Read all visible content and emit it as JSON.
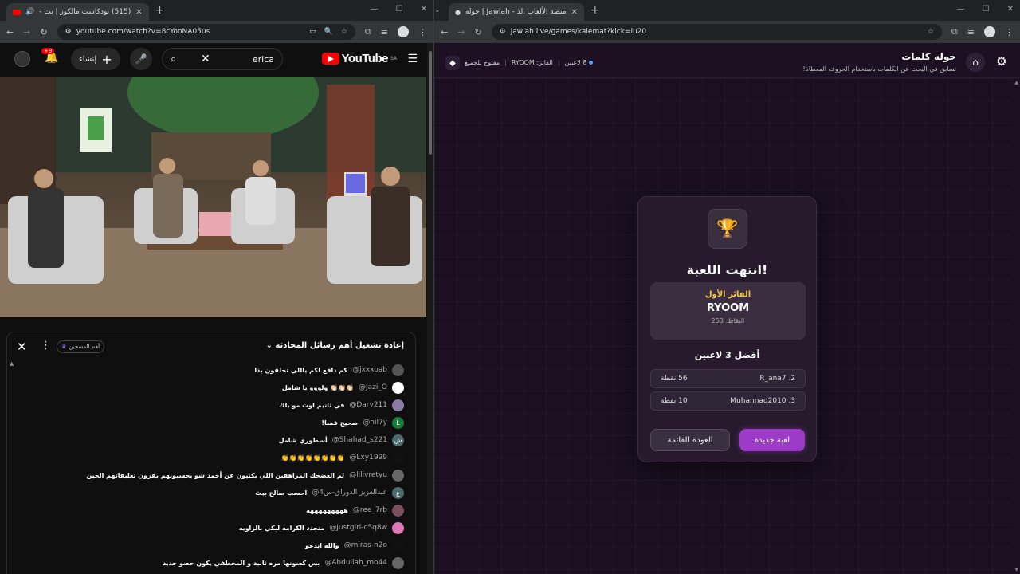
{
  "left": {
    "tab_title": "(515) بودكاست مالكوز | بت -",
    "url": "youtube.com/watch?v=8cYooNA05us",
    "yt": {
      "search_query": "erica",
      "region": "SA",
      "create_label": "إنشاء",
      "notif_count": "+9",
      "logo_text": "YouTube"
    },
    "chat": {
      "title": "إعادة تشغيل أهم رسائل المحادثة",
      "members_pill": "أهم المسجين",
      "messages": [
        {
          "author": "@jxxxoab",
          "text": "كم دافع لكم ياللي تحلفون بذا",
          "color": "#555"
        },
        {
          "author": "@Jazi_O",
          "text": "👏🏻👏🏻👏🏻 ولووو يا شامل",
          "color": "#fff"
        },
        {
          "author": "@Darv211",
          "text": "في ثانيم اوت مو ياك",
          "color": "#8a7aa8"
        },
        {
          "author": "@nil7y",
          "text": "صحيح فمنا!",
          "color": "#1a7a3a",
          "letter": "L"
        },
        {
          "author": "@Shahad_s221",
          "text": "أسطوري شامل",
          "color": "#4d6a6a",
          "letter": "ش"
        },
        {
          "author": "@Lxy1999",
          "text": "👏👏👏👏👏👏👏👏",
          "color": "#111"
        },
        {
          "author": "@lilivretyu",
          "text": "لم العضحك المراهقين اللي يكتبون عن أحمد شو يحسبونهم يقرون تعليقاتهم الحين",
          "color": "#666"
        },
        {
          "author": "@عبدالعزيز الدوراق-س4",
          "text": "احسب صالح بيث",
          "color": "#4d6a6a",
          "letter": "ع"
        },
        {
          "author": "@ree_7rb",
          "text": "هههههههههه",
          "color": "#7a5060"
        },
        {
          "author": "@Justgirl-c5q8w",
          "text": "متجدد الكرامه لبكي بالزاويه",
          "color": "#e07ab5"
        },
        {
          "author": "@miras-n2o",
          "text": "والله ابدعو",
          "color": "#111"
        },
        {
          "author": "@Abdullah_mo44",
          "text": "بس كسونها مره ثانية و المخطفي يكون حصو جديد",
          "color": "#666"
        }
      ]
    }
  },
  "right": {
    "tab_title": "جولة | Jawlah - منصة الألعاب الذ",
    "url": "jawlah.live/games/kalemat?kick=iu20",
    "header": {
      "title": "جوله كلمات",
      "subtitle": "تسابق في البحث عن الكلمات باستخدام الحروف المعطاة!",
      "players": "8 لاعبين",
      "winner_prefix": "الفائز:",
      "winner_name": "RYOOM",
      "open_label": "مفتوح للجميع"
    },
    "card": {
      "ended": "انتهت اللعبة!",
      "first_label": "الفائز الأول",
      "winner_name": "RYOOM",
      "winner_points": "النقاط: 253",
      "top3_title": "أفضل 3 لاعبين",
      "rows": [
        {
          "name": "2. R_ana7",
          "points": "56 نقطة"
        },
        {
          "name": "3. Muhannad2010",
          "points": "10 نقطة"
        }
      ],
      "new_game": "لعبة جديدة",
      "back": "العودة للقائمة"
    }
  }
}
